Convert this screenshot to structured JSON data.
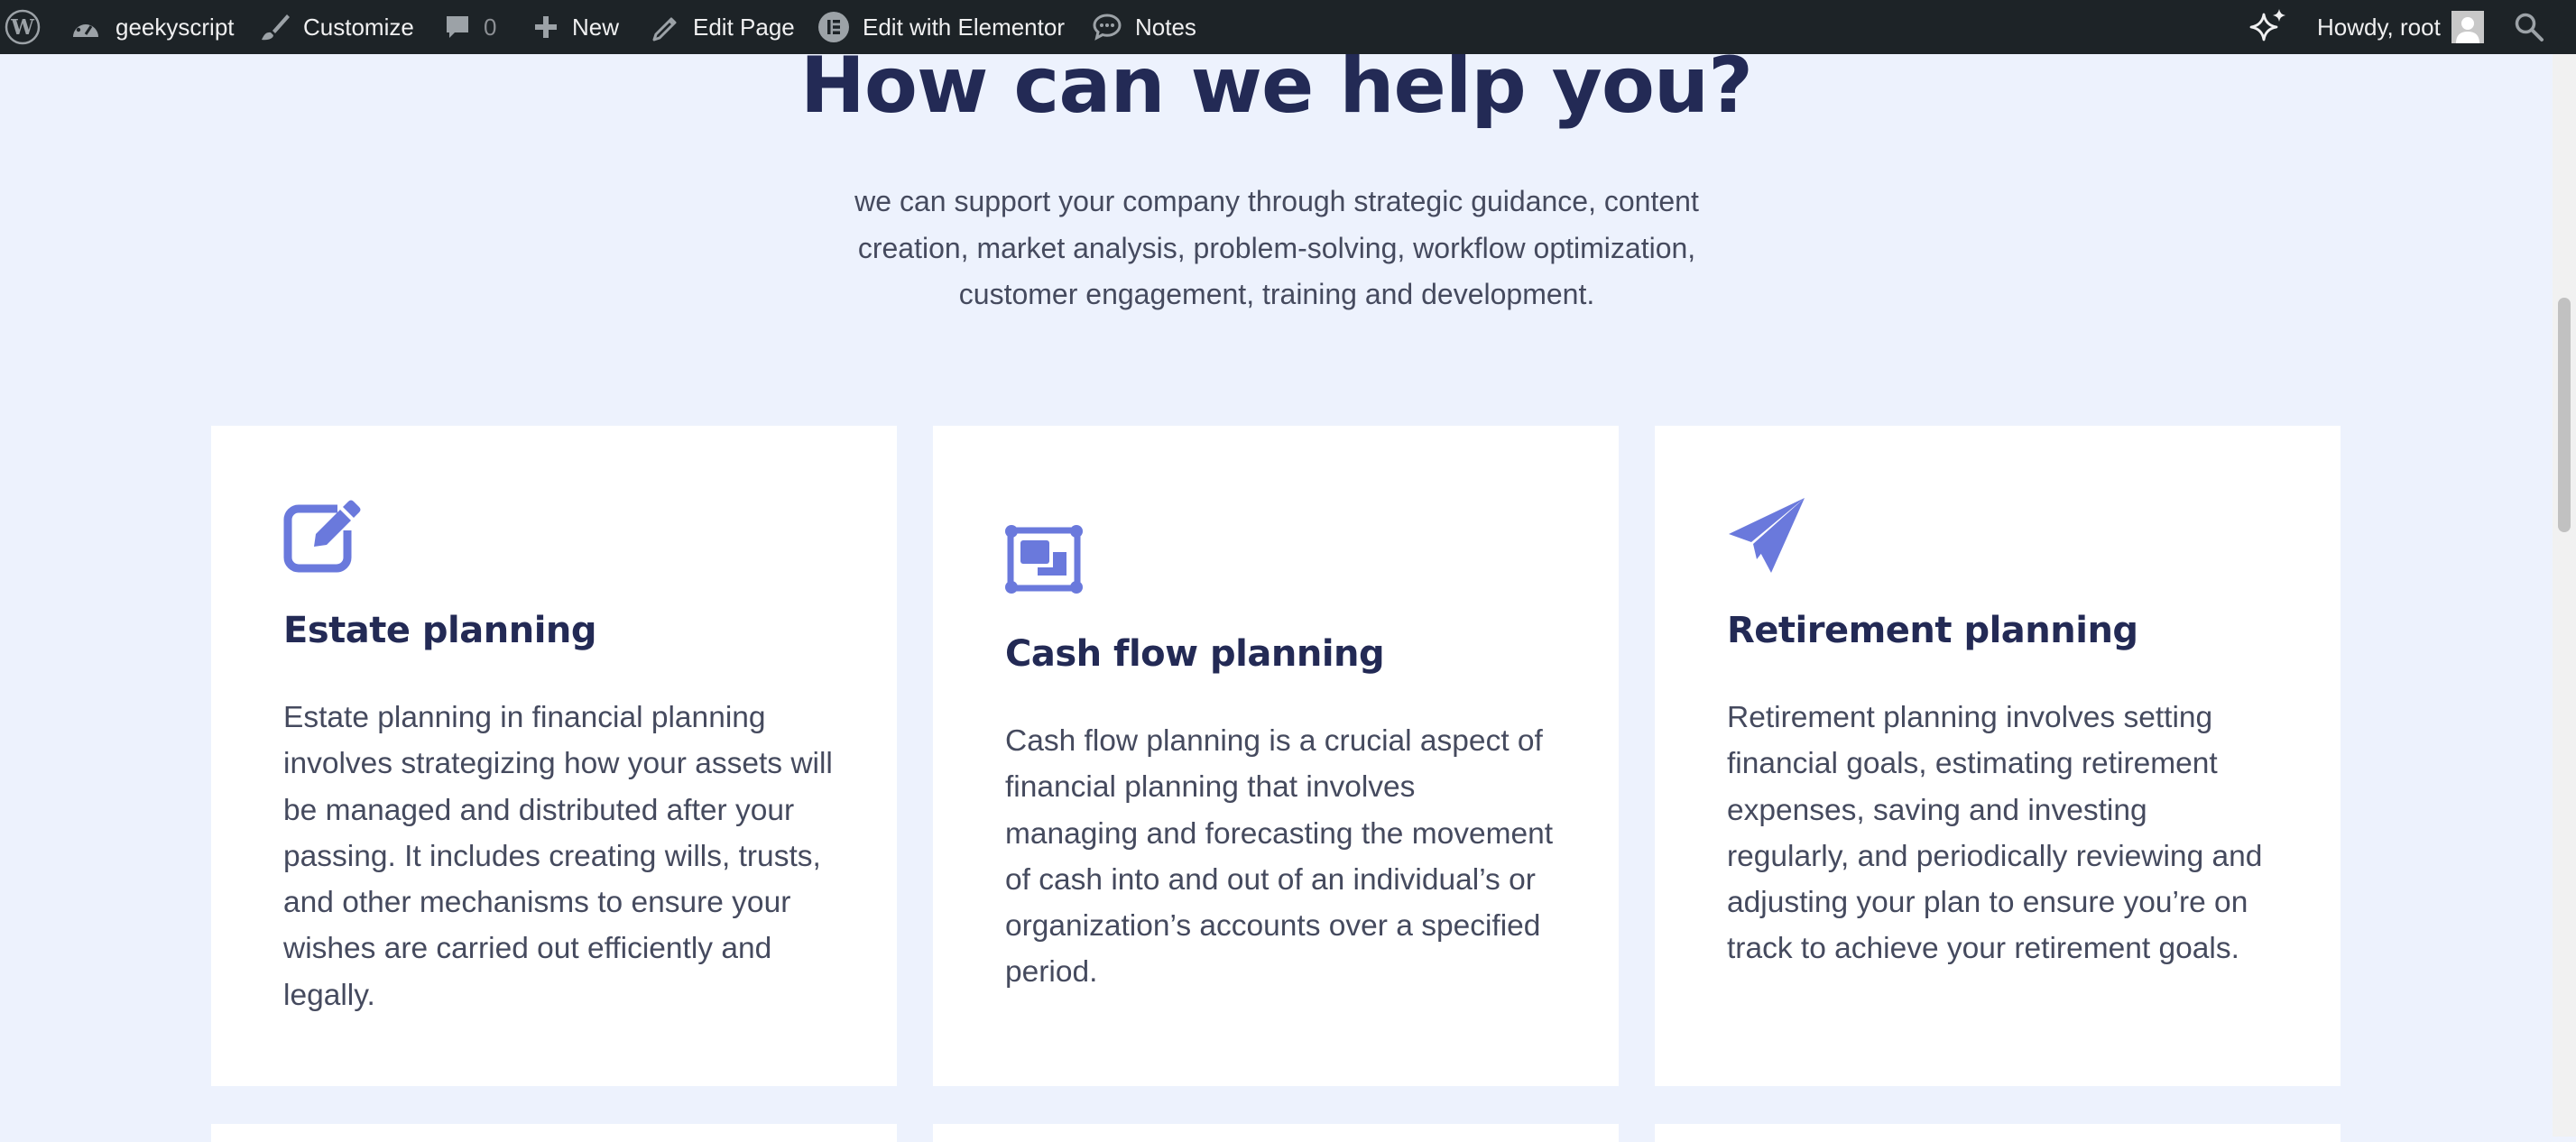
{
  "admin_bar": {
    "site_name": "geekyscript",
    "customize": "Customize",
    "comments_count": "0",
    "new": "New",
    "edit_page": "Edit Page",
    "edit_with_elementor": "Edit with Elementor",
    "notes": "Notes",
    "howdy": "Howdy, root"
  },
  "section": {
    "title": "How can we help you?",
    "intro": "we can support your company through strategic guidance, content creation, market analysis, problem-solving, workflow optimization, customer engagement, training and development."
  },
  "cards": [
    {
      "icon": "edit-square-icon",
      "title": "Estate planning",
      "text": "Estate planning in financial planning involves strategizing how your assets will be managed and distributed after your passing. It includes creating wills, trusts, and other mechanisms to ensure your wishes are carried out efficiently and legally."
    },
    {
      "icon": "object-group-icon",
      "title": "Cash flow planning",
      "text": "Cash flow planning is a crucial aspect of financial planning that involves managing and forecasting the movement of cash into and out of an individual’s or organization’s accounts over a specified period."
    },
    {
      "icon": "paper-plane-icon",
      "title": "Retirement planning",
      "text": "Retirement planning involves setting financial goals, estimating retirement expenses, saving and investing regularly, and periodically reviewing and adjusting your plan to ensure you’re on track to achieve your retirement goals."
    }
  ],
  "colors": {
    "accent": "#6a79dc",
    "heading": "#232a55",
    "body_text": "#454a5e",
    "background": "#edf2fd",
    "admin_bar": "#1d2327"
  }
}
